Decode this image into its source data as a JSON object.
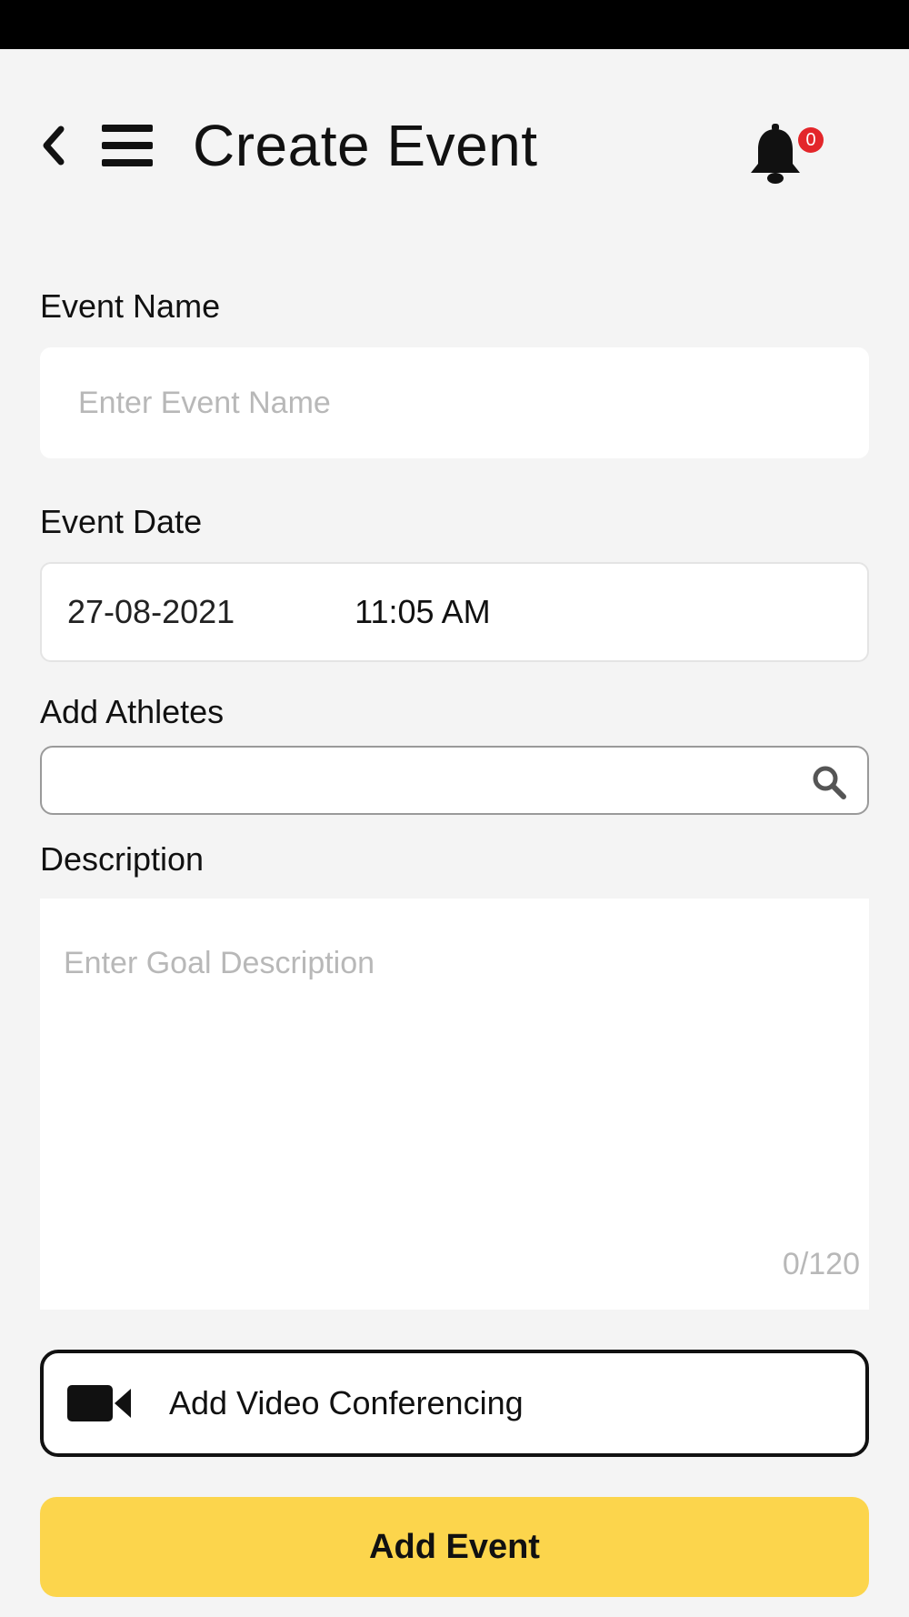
{
  "header": {
    "back_icon": "chevron-left-icon",
    "menu_icon": "hamburger-menu-icon",
    "title": "Create Event",
    "notification_icon": "bell-icon",
    "notification_count": "0"
  },
  "form": {
    "event_name": {
      "label": "Event Name",
      "value": "",
      "placeholder": "Enter Event Name"
    },
    "event_date": {
      "label": "Event Date",
      "date": "27-08-2021",
      "time": "11:05 AM"
    },
    "athletes": {
      "label": "Add Athletes",
      "value": "",
      "placeholder": "",
      "icon": "search-icon"
    },
    "description": {
      "label": "Description",
      "value": "",
      "placeholder": "Enter Goal Description",
      "counter": "0/120"
    }
  },
  "actions": {
    "video_conferencing": {
      "label": "Add Video Conferencing",
      "icon": "video-camera-icon"
    },
    "add_event": {
      "label": "Add Event"
    }
  },
  "colors": {
    "accent": "#fcd54c",
    "badge": "#e3262a",
    "background": "#f4f4f4",
    "status_bar": "#000000"
  }
}
